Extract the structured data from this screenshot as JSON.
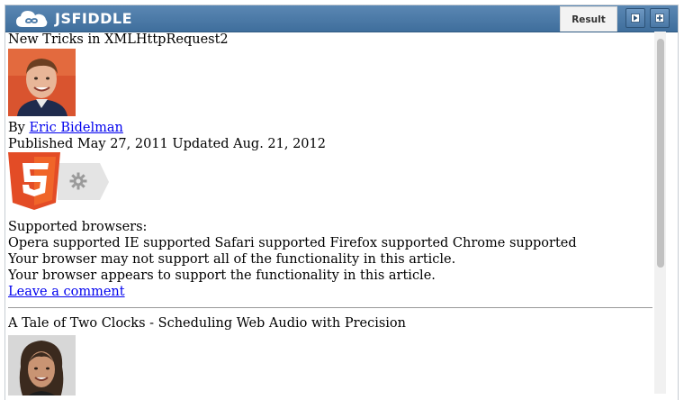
{
  "app": {
    "brand": "JSFIDDLE"
  },
  "tabs": {
    "result_label": "Result"
  },
  "articles": [
    {
      "title": "New Tricks in XMLHttpRequest2",
      "by_prefix": "By ",
      "author": "Eric Bidelman",
      "published": "Published May 27, 2011 Updated Aug. 21, 2012",
      "supported_heading": "Supported browsers:",
      "browsers_line": "Opera supported IE supported Safari supported Firefox supported Chrome supported",
      "warning1": "Your browser may not support all of the functionality in this article.",
      "warning2": "Your browser appears to support the functionality in this article.",
      "comment_link": "Leave a comment"
    },
    {
      "title": "A Tale of Two Clocks - Scheduling Web Audio with Precision"
    }
  ],
  "colors": {
    "topbar": "#4a7aa8",
    "link": "#0000ee",
    "html5_orange": "#e34c26"
  },
  "icons": [
    "cloud-logo-icon",
    "play-icon",
    "plus-icon",
    "html5-badge-icon",
    "gear-icon"
  ]
}
